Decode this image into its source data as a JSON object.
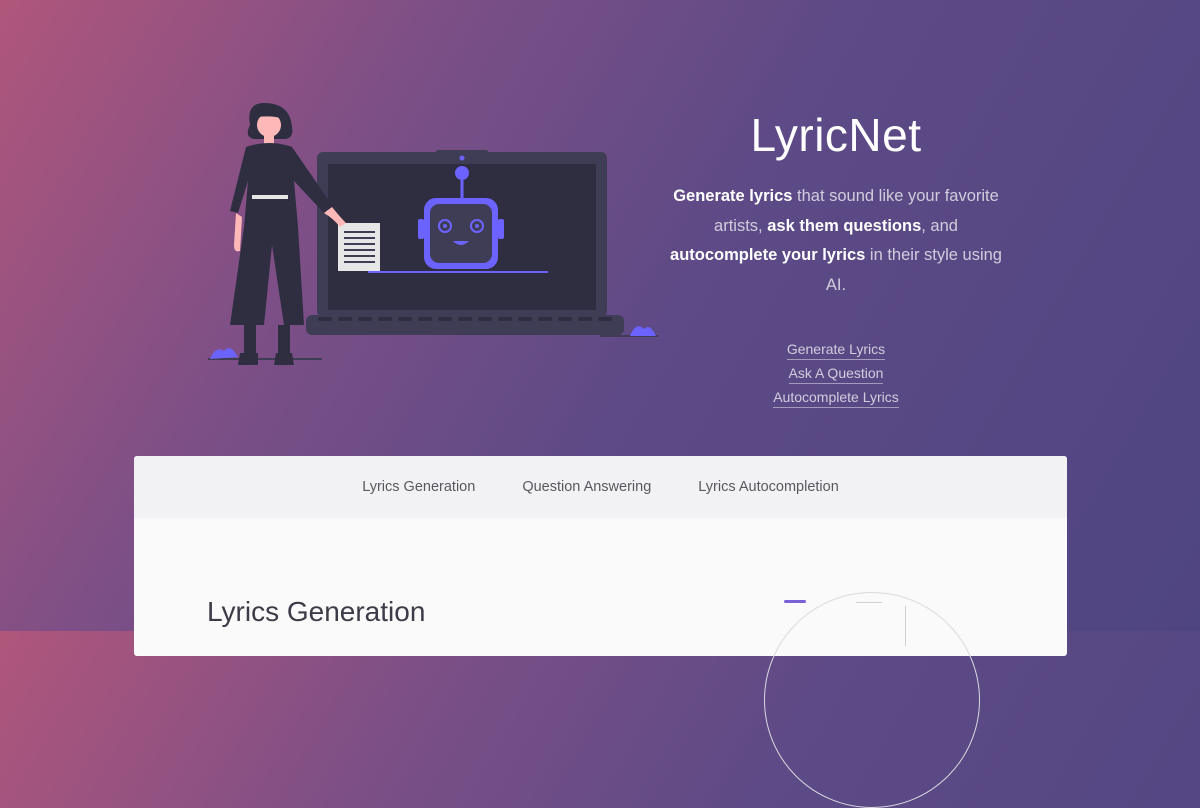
{
  "hero": {
    "title": "LyricNet",
    "tagline": {
      "p1_bold": "Generate lyrics",
      "p1_rest": " that sound like your favorite artists, ",
      "p2_bold": "ask them questions",
      "p2_rest": ", and ",
      "p3_bold": "autocomplete your lyrics",
      "p3_rest": " in their style using AI."
    },
    "links": [
      "Generate Lyrics",
      "Ask A Question",
      "Autocomplete Lyrics"
    ]
  },
  "panel": {
    "tabs": [
      "Lyrics Generation",
      "Question Answering",
      "Lyrics Autocompletion"
    ],
    "section_title": "Lyrics Generation"
  },
  "colors": {
    "accent": "#6c63ff",
    "bg_gradient_start": "#b0567b",
    "bg_gradient_end": "#4f4581",
    "laptop": "#3f3d56",
    "screen": "#2f2e41"
  },
  "illustration": {
    "name": "woman-presenting-robot-on-laptop"
  }
}
